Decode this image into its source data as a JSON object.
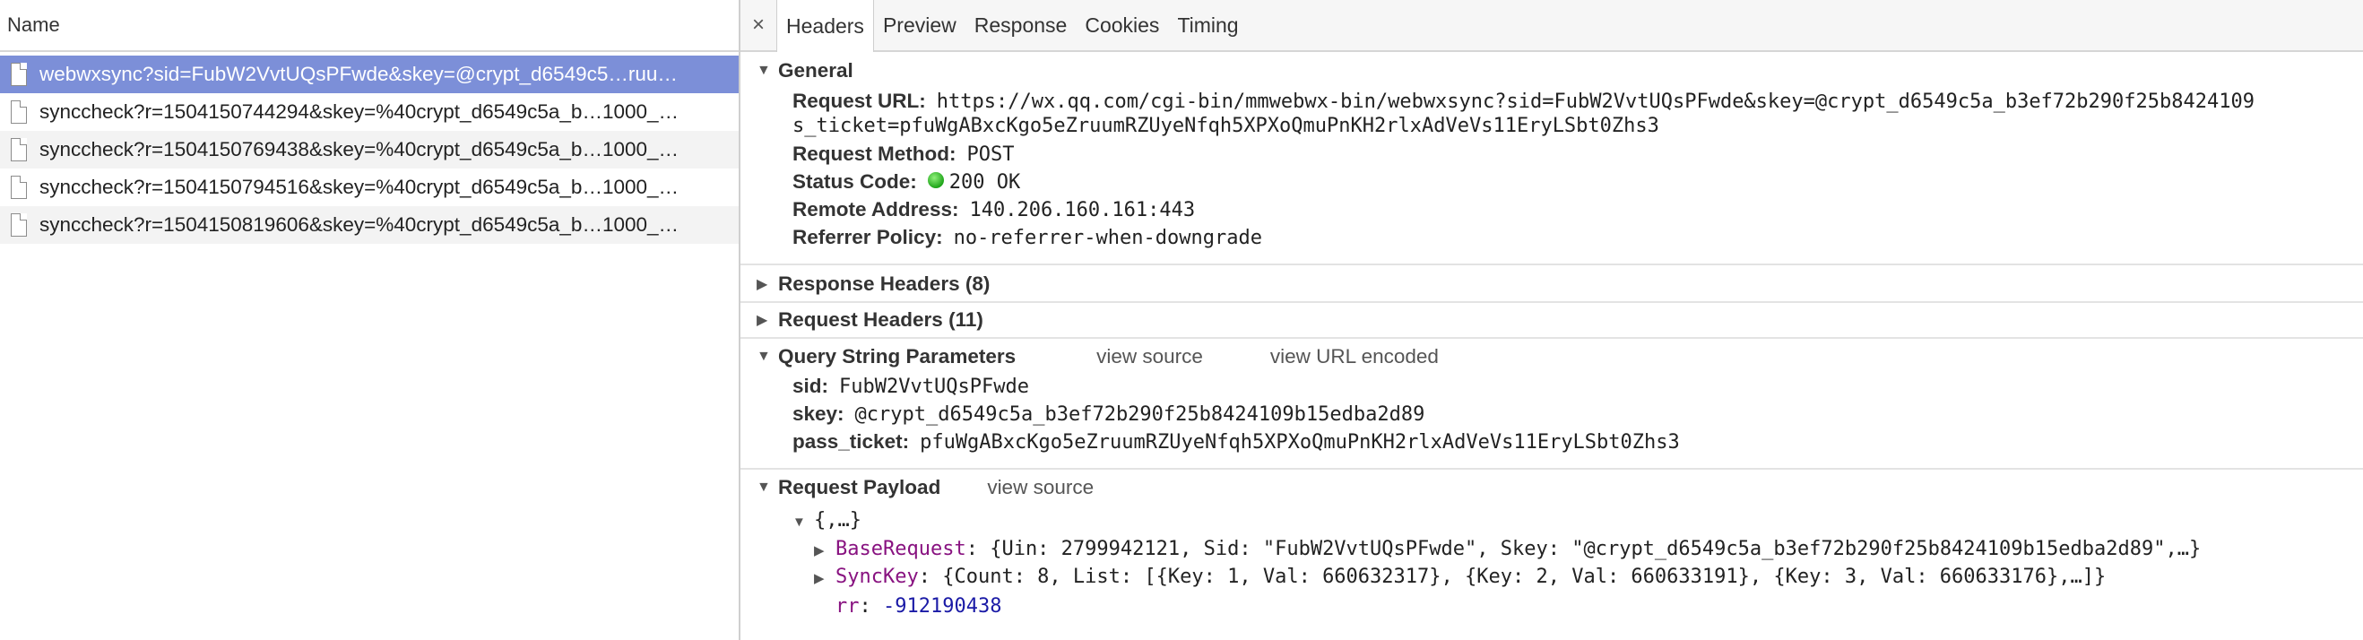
{
  "left_panel": {
    "header": "Name",
    "requests": [
      {
        "name": "webwxsync?sid=FubW2VvtUQsPFwde&skey=@crypt_d6549c5…ruu…",
        "selected": true
      },
      {
        "name": "synccheck?r=1504150744294&skey=%40crypt_d6549c5a_b…1000_…",
        "selected": false
      },
      {
        "name": "synccheck?r=1504150769438&skey=%40crypt_d6549c5a_b…1000_…",
        "selected": false
      },
      {
        "name": "synccheck?r=1504150794516&skey=%40crypt_d6549c5a_b…1000_…",
        "selected": false
      },
      {
        "name": "synccheck?r=1504150819606&skey=%40crypt_d6549c5a_b…1000_…",
        "selected": false
      }
    ]
  },
  "tabs": {
    "close": "×",
    "items": [
      "Headers",
      "Preview",
      "Response",
      "Cookies",
      "Timing"
    ],
    "active": "Headers"
  },
  "general": {
    "title": "General",
    "request_url_label": "Request URL:",
    "request_url_line1": "https://wx.qq.com/cgi-bin/mmwebwx-bin/webwxsync?sid=FubW2VvtUQsPFwde&skey=@crypt_d6549c5a_b3ef72b290f25b8424109",
    "request_url_line2": "s_ticket=pfuWgABxcKgo5eZruumRZUyeNfqh5XPXoQmuPnKH2rlxAdVeVs11EryLSbt0Zhs3",
    "method_label": "Request Method:",
    "method": "POST",
    "status_label": "Status Code:",
    "status": "200 OK",
    "remote_label": "Remote Address:",
    "remote": "140.206.160.161:443",
    "referrer_label": "Referrer Policy:",
    "referrer": "no-referrer-when-downgrade"
  },
  "response_headers": "Response Headers (8)",
  "request_headers": "Request Headers (11)",
  "query": {
    "title": "Query String Parameters",
    "view_source": "view source",
    "view_url_encoded": "view URL encoded",
    "params": [
      {
        "key": "sid:",
        "value": "FubW2VvtUQsPFwde"
      },
      {
        "key": "skey:",
        "value": "@crypt_d6549c5a_b3ef72b290f25b8424109b15edba2d89"
      },
      {
        "key": "pass_ticket:",
        "value": "pfuWgABxcKgo5eZruumRZUyeNfqh5XPXoQmuPnKH2rlxAdVeVs11EryLSbt0Zhs3"
      }
    ]
  },
  "payload": {
    "title": "Request Payload",
    "view_source": "view source",
    "root": "{,…}",
    "base_request_key": "BaseRequest",
    "base_request_value": "{Uin: 2799942121, Sid: \"FubW2VvtUQsPFwde\", Skey: \"@crypt_d6549c5a_b3ef72b290f25b8424109b15edba2d89\",…}",
    "sync_key_key": "SyncKey",
    "sync_key_value": "{Count: 8, List: [{Key: 1, Val: 660632317}, {Key: 2, Val: 660633191}, {Key: 3, Val: 660633176},…]}",
    "rr_key": "rr",
    "rr_value": "-912190438"
  },
  "colors": {
    "selected_row": "#7c8fd8",
    "status_green": "#1fa51a",
    "payload_key": "#881280",
    "payload_number": "#1a1aa6"
  }
}
